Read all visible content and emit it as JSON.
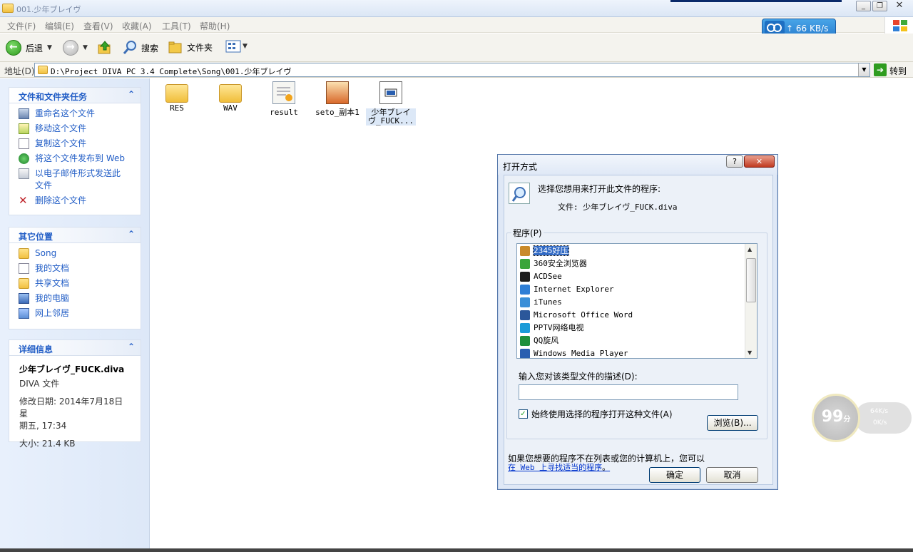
{
  "window": {
    "title": "001.少年ブレイヴ"
  },
  "menu": [
    "文件(F)",
    "编辑(E)",
    "查看(V)",
    "收藏(A)",
    "工具(T)",
    "帮助(H)"
  ],
  "net_badge": {
    "speed": "66 KB/s"
  },
  "toolbar": {
    "back": "后退",
    "search": "搜索",
    "folders": "文件夹"
  },
  "address": {
    "label": "地址(D)",
    "path": "D:\\Project DIVA PC 3.4 Complete\\Song\\001.少年ブレイヴ",
    "go": "转到"
  },
  "tasks": {
    "title": "文件和文件夹任务",
    "items": [
      "重命名这个文件",
      "移动这个文件",
      "复制这个文件",
      "将这个文件发布到 Web",
      "以电子邮件形式发送此",
      "文件",
      "删除这个文件"
    ]
  },
  "places": {
    "title": "其它位置",
    "items": [
      "Song",
      "我的文档",
      "共享文档",
      "我的电脑",
      "网上邻居"
    ]
  },
  "details": {
    "title": "详细信息",
    "filename": "少年ブレイヴ_FUCK.diva",
    "type": "DIVA 文件",
    "modified_1": "修改日期: 2014年7月18日星",
    "modified_2": "期五, 17:34",
    "size": "大小: 21.4 KB"
  },
  "files": [
    {
      "label": "RES",
      "kind": "folder"
    },
    {
      "label": "WAV",
      "kind": "folder"
    },
    {
      "label": "result",
      "kind": "script"
    },
    {
      "label": "seto_副本1",
      "kind": "image"
    },
    {
      "label_1": "少年ブレイ",
      "label_2": "ヴ_FUCK...",
      "kind": "diva"
    }
  ],
  "dialog": {
    "title": "打开方式",
    "help": "?",
    "prompt": "选择您想用来打开此文件的程序:",
    "file_line": "文件: 少年ブレイヴ_FUCK.diva",
    "programs_label": "程序(P)",
    "programs": [
      "2345好压",
      "360安全浏览器",
      "ACDSee",
      "Internet Explorer",
      "iTunes",
      "Microsoft Office Word",
      "PPTV网络电视",
      "QQ旋风",
      "Windows Media Player"
    ],
    "program_colors": [
      "#c98a2a",
      "#3aa53a",
      "#1e1e1e",
      "#2f7fd6",
      "#3a8fd8",
      "#2b579a",
      "#1a9bd8",
      "#1e8f3c",
      "#2a5fb0"
    ],
    "selected_program": "2345好压",
    "desc_label": "输入您对该类型文件的描述(D):",
    "always_label": "始终使用选择的程序打开这种文件(A)",
    "always_checked": true,
    "browse": "浏览(B)...",
    "footer_1": "如果您想要的程序不在列表或您的计算机上，您可以",
    "footer_link": "在 Web 上寻找适当的程序",
    "footer_end": "。",
    "ok": "确定",
    "cancel": "取消"
  },
  "widget": {
    "score": "99",
    "unit": "分",
    "up": "64K/s",
    "down": "0K/s"
  }
}
